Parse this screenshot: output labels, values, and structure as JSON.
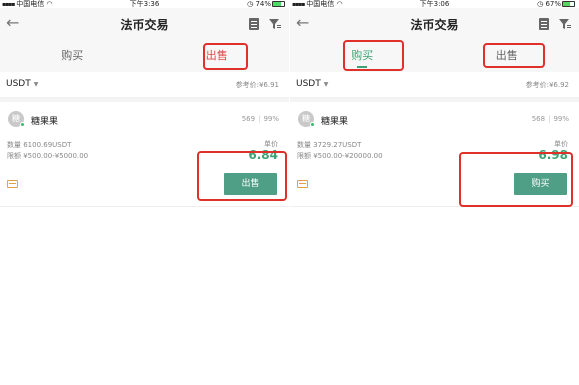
{
  "left": {
    "status": {
      "carrier": "中国电信",
      "time": "下午3:36",
      "battery": "74%",
      "battery_level": 0.74
    },
    "nav": {
      "title": "法币交易"
    },
    "tabs": [
      {
        "label": "购买"
      },
      {
        "label": "出售"
      }
    ],
    "currency": "USDT",
    "reference_price": "参考价:¥6.91",
    "ad": {
      "avatar_char": "糖",
      "name": "糖果果",
      "orders": "569",
      "completion": "99%",
      "quantity": "数量 6100.69USDT",
      "limit": "限额 ¥500.00-¥5000.00",
      "unit_price_label": "单价",
      "price": "6.84",
      "action": "出售"
    }
  },
  "right": {
    "status": {
      "carrier": "中国电信",
      "time": "下午3:06",
      "battery": "67%",
      "battery_level": 0.67
    },
    "nav": {
      "title": "法币交易"
    },
    "tabs": [
      {
        "label": "购买"
      },
      {
        "label": "出售"
      }
    ],
    "currency": "USDT",
    "reference_price": "参考价:¥6.92",
    "ad": {
      "avatar_char": "糖",
      "name": "糖果果",
      "orders": "568",
      "completion": "99%",
      "quantity": "数量 3729.27USDT",
      "limit": "限额 ¥500.00-¥20000.00",
      "unit_price_label": "单价",
      "price": "6.98",
      "action": "购买"
    }
  },
  "colors": {
    "sell_accent": "#e04a4a",
    "buy_accent": "#3da374",
    "button": "#4f9e86",
    "highlight": "#e0302a"
  },
  "icons": [
    "back-arrow-icon",
    "document-icon",
    "filter-icon",
    "payment-card-icon",
    "wifi-icon",
    "alarm-icon",
    "battery-icon"
  ]
}
